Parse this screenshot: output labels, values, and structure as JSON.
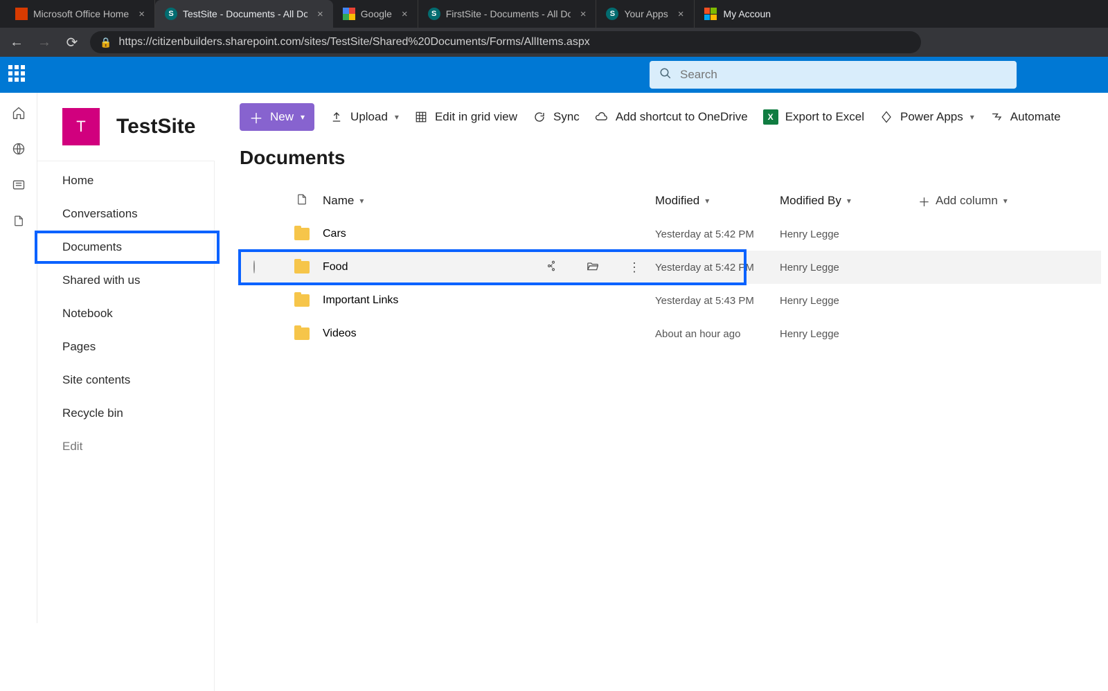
{
  "browser": {
    "tabs": [
      {
        "title": "Microsoft Office Home",
        "favicon": "office"
      },
      {
        "title": "TestSite - Documents - All Docum",
        "favicon": "sharepoint",
        "active": true
      },
      {
        "title": "Google",
        "favicon": "google"
      },
      {
        "title": "FirstSite - Documents - All Docum",
        "favicon": "sharepoint"
      },
      {
        "title": "Your Apps",
        "favicon": "sharepoint"
      }
    ],
    "overflow_tab": "My Accoun",
    "url": "https://citizenbuilders.sharepoint.com/sites/TestSite/Shared%20Documents/Forms/AllItems.aspx"
  },
  "suite": {
    "search_placeholder": "Search"
  },
  "site": {
    "logo_letter": "T",
    "title": "TestSite"
  },
  "sidenav": {
    "items": [
      "Home",
      "Conversations",
      "Documents",
      "Shared with us",
      "Notebook",
      "Pages",
      "Site contents",
      "Recycle bin"
    ],
    "edit_label": "Edit",
    "selected_index": 2
  },
  "commandbar": {
    "new": "New",
    "upload": "Upload",
    "edit_grid": "Edit in grid view",
    "sync": "Sync",
    "onedrive": "Add shortcut to OneDrive",
    "export": "Export to Excel",
    "powerapps": "Power Apps",
    "automate": "Automate"
  },
  "library": {
    "title": "Documents",
    "columns": {
      "name": "Name",
      "modified": "Modified",
      "modified_by": "Modified By",
      "add": "Add column"
    },
    "rows": [
      {
        "name": "Cars",
        "modified": "Yesterday at 5:42 PM",
        "by": "Henry Legge"
      },
      {
        "name": "Food",
        "modified": "Yesterday at 5:42 PM",
        "by": "Henry Legge",
        "hovered": true,
        "highlighted": true
      },
      {
        "name": "Important Links",
        "modified": "Yesterday at 5:43 PM",
        "by": "Henry Legge"
      },
      {
        "name": "Videos",
        "modified": "About an hour ago",
        "by": "Henry Legge"
      }
    ]
  }
}
